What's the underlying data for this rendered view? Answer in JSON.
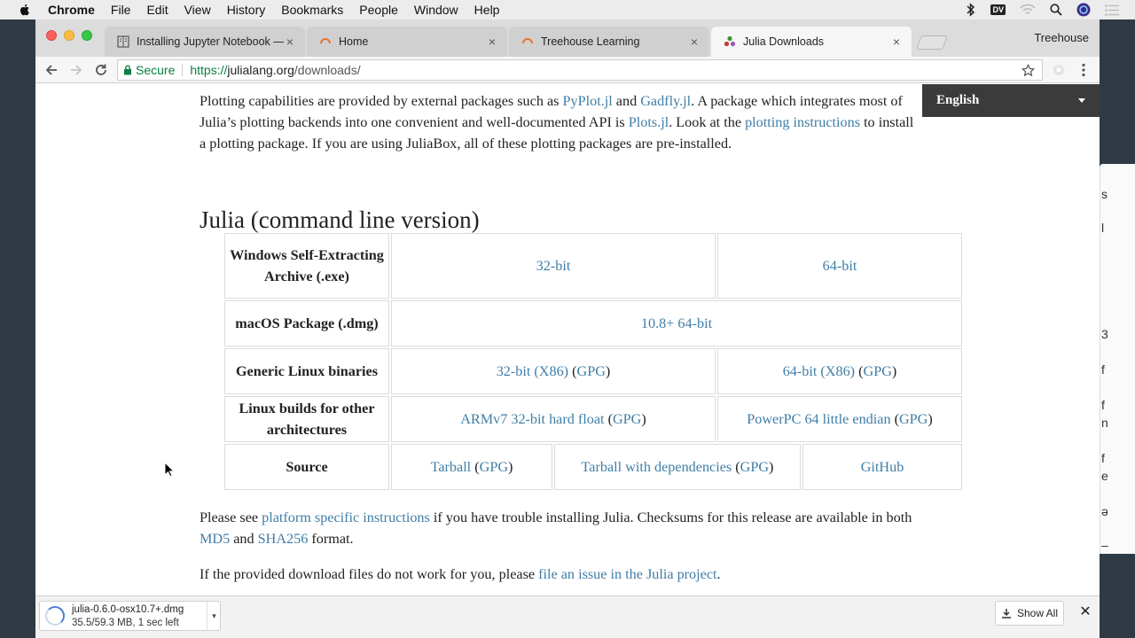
{
  "menubar": {
    "app": "Chrome",
    "items": [
      "File",
      "Edit",
      "View",
      "History",
      "Bookmarks",
      "People",
      "Window",
      "Help"
    ],
    "dv_badge": "DV"
  },
  "browser": {
    "tabs": [
      {
        "title": "Installing Jupyter Notebook —",
        "active": false
      },
      {
        "title": "Home",
        "active": false
      },
      {
        "title": "Treehouse Learning",
        "active": false
      },
      {
        "title": "Julia Downloads",
        "active": true
      }
    ],
    "profile": "Treehouse",
    "secure_label": "Secure",
    "url_scheme": "https://",
    "url_host": "julialang.org",
    "url_path": "/downloads/"
  },
  "page": {
    "language_selector": "English",
    "intro": {
      "t1": "Plotting capabilities are provided by external packages such as ",
      "l1": "PyPlot.jl",
      "t2": " and ",
      "l2": "Gadfly.jl",
      "t3": ". A package which integrates most of Julia’s plotting backends into one convenient and well-documented API is ",
      "l3": "Plots.jl",
      "t4": ". Look at the ",
      "l4": "plotting instructions",
      "t5": " to install a plotting package. If you are using JuliaBox, all of these plotting packages are pre-installed."
    },
    "section_title": "Julia (command line version)",
    "table": {
      "win_label": "Windows Self-Extracting Archive (.exe)",
      "win_32": "32-bit",
      "win_64": "64-bit",
      "mac_label": "macOS Package (.dmg)",
      "mac_link": "10.8+ 64-bit",
      "linux_label": "Generic Linux binaries",
      "linux_32": "32-bit (X86)",
      "linux_64": "64-bit (X86)",
      "gpg": "GPG",
      "other_label": "Linux builds for other architectures",
      "arm": "ARMv7 32-bit hard float",
      "ppc": "PowerPC 64 little endian",
      "source_label": "Source",
      "tarball": "Tarball",
      "tarball_deps": "Tarball with dependencies",
      "github": "GitHub"
    },
    "checksums": {
      "t1": "Please see ",
      "l1": "platform specific instructions",
      "t2": " if you have trouble installing Julia. Checksums for this release are available in both ",
      "l2": "MD5",
      "t3": " and ",
      "l3": "SHA256",
      "t4": " format."
    },
    "issue": {
      "t1": "If the provided download files do not work for you, please ",
      "l1": "file an issue in the Julia project",
      "t2": "."
    }
  },
  "downloads": {
    "file_name": "julia-0.6.0-osx10.7+.dmg",
    "status": "35.5/59.3 MB, 1 sec left",
    "show_all": "Show All"
  },
  "background_window_glyphs": [
    "s",
    "l",
    "3",
    "f",
    "f",
    "n",
    "f",
    "e",
    "ə",
    "–"
  ]
}
